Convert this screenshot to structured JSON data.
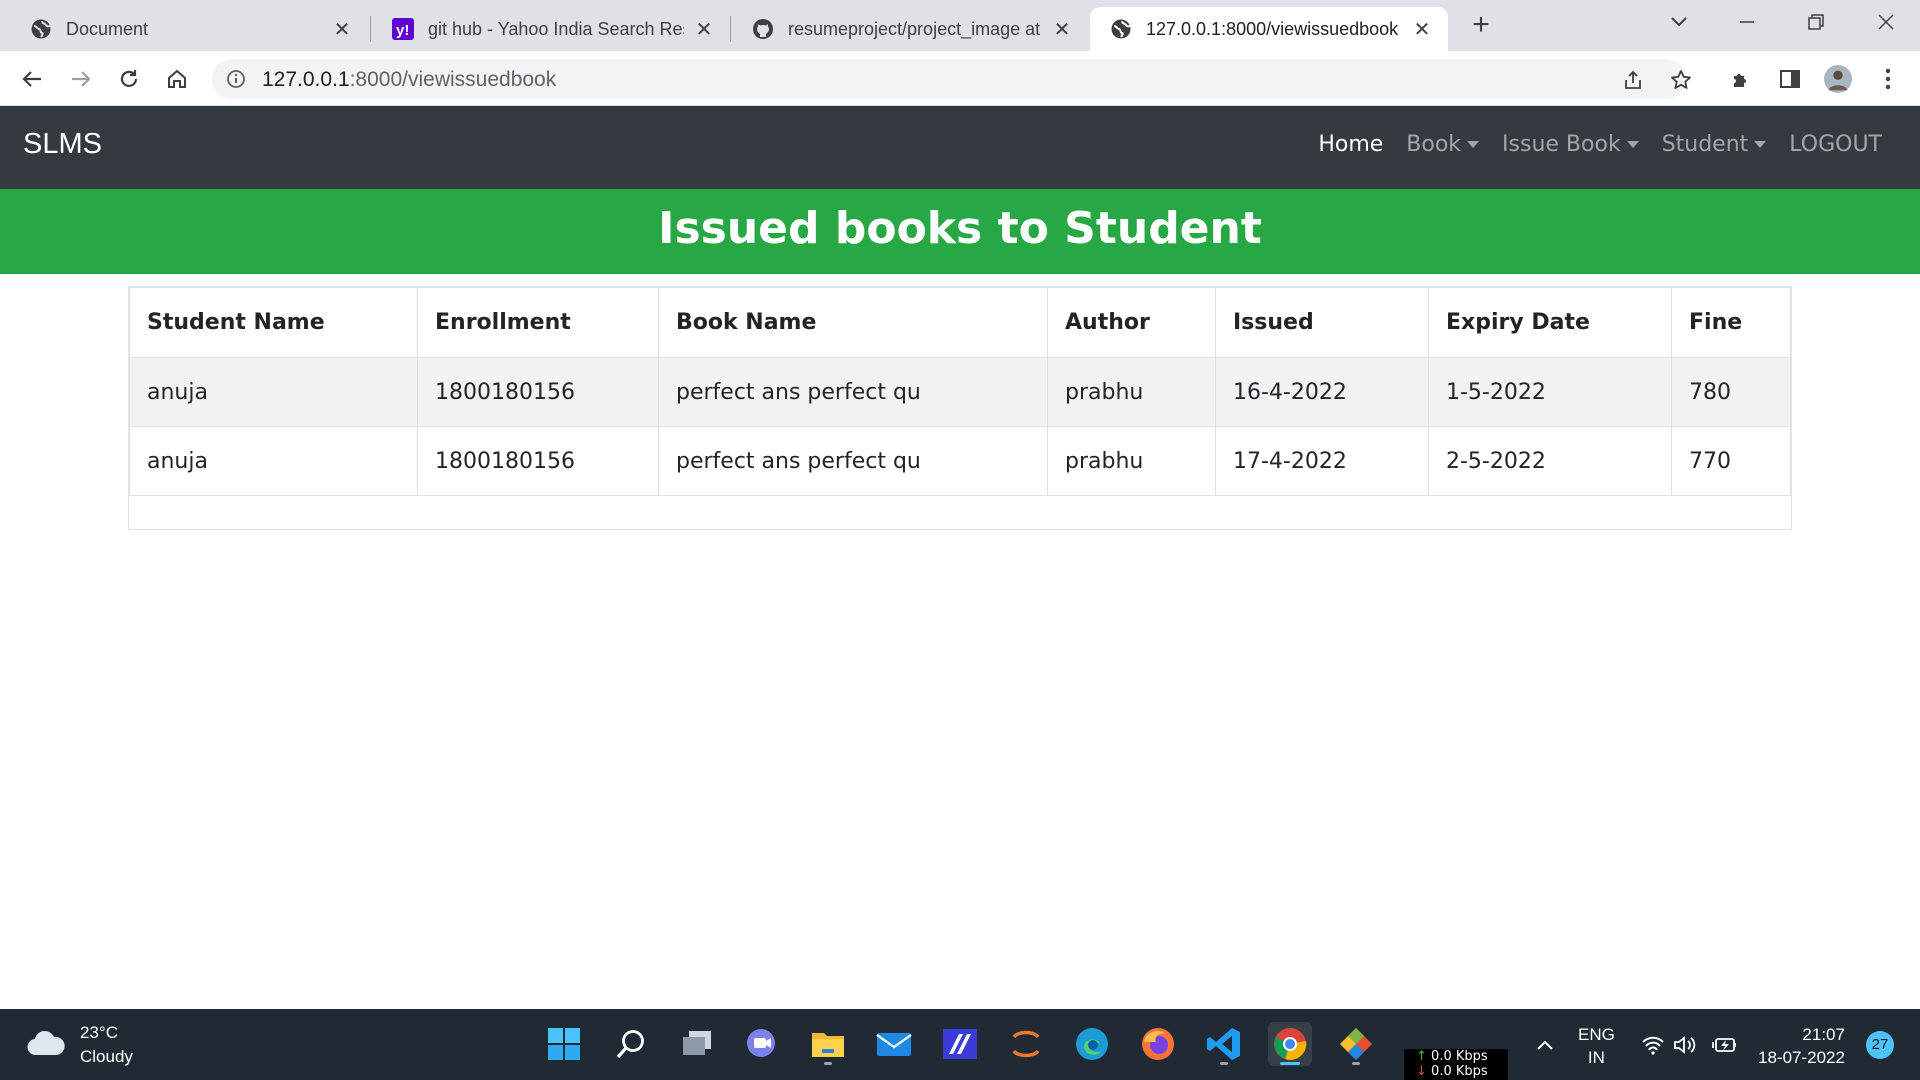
{
  "browser": {
    "tabs": [
      {
        "title": "Document",
        "icon": "globe-icon",
        "active": false
      },
      {
        "title": "git hub - Yahoo India Search Res",
        "icon": "yahoo-icon",
        "active": false
      },
      {
        "title": "resumeproject/project_image at",
        "icon": "github-icon",
        "active": false
      },
      {
        "title": "127.0.0.1:8000/viewissuedbook",
        "icon": "globe-icon",
        "active": true
      }
    ],
    "new_tab_label": "+",
    "url_host": "127.0.0.1",
    "url_path": ":8000/viewissuedbook"
  },
  "site": {
    "brand": "SLMS",
    "nav": [
      {
        "label": "Home",
        "active": true,
        "dropdown": false
      },
      {
        "label": "Book",
        "active": false,
        "dropdown": true
      },
      {
        "label": "Issue Book",
        "active": false,
        "dropdown": true
      },
      {
        "label": "Student",
        "active": false,
        "dropdown": true
      },
      {
        "label": "LOGOUT",
        "active": false,
        "dropdown": false
      }
    ],
    "banner_title": "Issued books to Student",
    "colors": {
      "navbar": "#343a40",
      "banner": "#28a745"
    }
  },
  "table": {
    "headers": [
      "Student Name",
      "Enrollment",
      "Book Name",
      "Author",
      "Issued",
      "Expiry Date",
      "Fine"
    ],
    "rows": [
      [
        "anuja",
        "1800180156",
        "perfect ans perfect qu",
        "prabhu",
        "16-4-2022",
        "1-5-2022",
        "780"
      ],
      [
        "anuja",
        "1800180156",
        "perfect ans perfect qu",
        "prabhu",
        "17-4-2022",
        "2-5-2022",
        "770"
      ]
    ]
  },
  "taskbar": {
    "weather_temp": "23°C",
    "weather_desc": "Cloudy",
    "net_up": "0.0 Kbps",
    "net_down": "0.0 Kbps",
    "lang_primary": "ENG",
    "lang_region": "IN",
    "time": "21:07",
    "date": "18-07-2022",
    "notifications": "27"
  }
}
